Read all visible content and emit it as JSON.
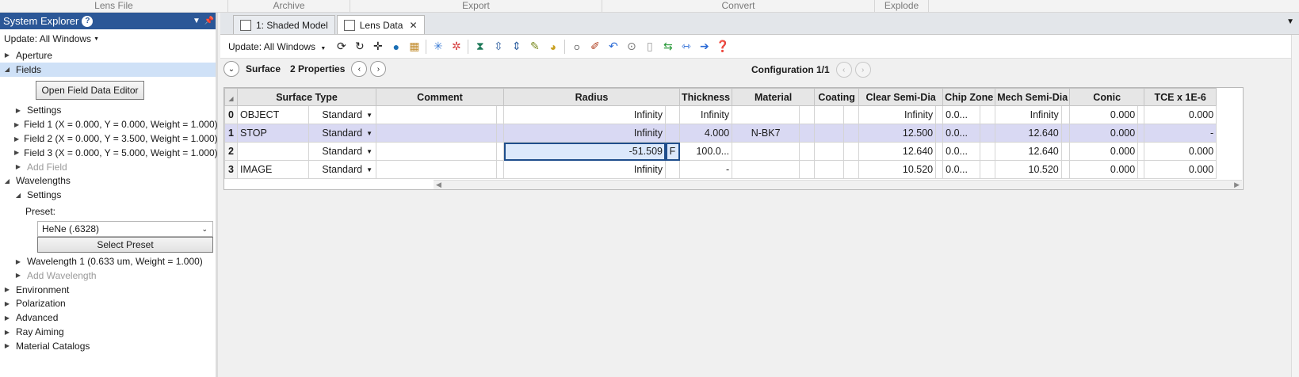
{
  "ribbon": {
    "groups": [
      "Lens File",
      "Archive",
      "Export",
      "Convert",
      "Explode"
    ]
  },
  "explorer": {
    "title": "System Explorer",
    "help": "?",
    "update_label": "Update: All Windows",
    "items": {
      "aperture": "Aperture",
      "fields": "Fields",
      "open_field_editor": "Open Field Data Editor",
      "field_settings": "Settings",
      "field1": "Field 1 (X = 0.000, Y = 0.000, Weight = 1.000)",
      "field2": "Field 2 (X = 0.000, Y = 3.500, Weight = 1.000)",
      "field3": "Field 3 (X = 0.000, Y = 5.000, Weight = 1.000)",
      "add_field": "Add Field",
      "wavelengths": "Wavelengths",
      "wl_settings": "Settings",
      "preset_label": "Preset:",
      "preset_value": "HeNe (.6328)",
      "select_preset": "Select Preset",
      "wavelength1": "Wavelength 1 (0.633 um, Weight = 1.000)",
      "add_wavelength": "Add Wavelength",
      "environment": "Environment",
      "polarization": "Polarization",
      "advanced": "Advanced",
      "ray_aiming": "Ray Aiming",
      "material_catalogs": "Material Catalogs"
    }
  },
  "tabs": [
    {
      "label": "1: Shaded Model"
    },
    {
      "label": "Lens Data"
    }
  ],
  "toolbar": {
    "update_label": "Update: All Windows"
  },
  "propbar": {
    "surface_label": "Surface",
    "properties_label": "2 Properties",
    "config_label": "Configuration 1/1"
  },
  "table": {
    "headers": [
      "Surface Type",
      "Comment",
      "Radius",
      "Thickness",
      "Material",
      "Coating",
      "Clear Semi-Dia",
      "Chip Zone",
      "Mech Semi-Dia",
      "Conic",
      "TCE x 1E-6"
    ],
    "rows": [
      {
        "num": "0",
        "name": "OBJECT",
        "type": "Standard",
        "comment": "",
        "radius": "Infinity",
        "radius_solve": "",
        "thickness": "Infinity",
        "material": "",
        "coating": "",
        "clear": "Infinity",
        "chip": "0.0...",
        "mech": "Infinity",
        "conic": "0.000",
        "tce": "0.000"
      },
      {
        "num": "1",
        "name": "STOP",
        "type": "Standard",
        "comment": "",
        "radius": "Infinity",
        "radius_solve": "",
        "thickness": "4.000",
        "material": "N-BK7",
        "coating": "",
        "clear": "12.500",
        "chip": "0.0...",
        "mech": "12.640",
        "conic": "0.000",
        "tce": "-"
      },
      {
        "num": "2",
        "name": "",
        "type": "Standard",
        "comment": "",
        "radius": "-51.509",
        "radius_solve": "F",
        "thickness": "100.0...",
        "material": "",
        "coating": "",
        "clear": "12.640",
        "chip": "0.0...",
        "mech": "12.640",
        "conic": "0.000",
        "tce": "0.000"
      },
      {
        "num": "3",
        "name": "IMAGE",
        "type": "Standard",
        "comment": "",
        "radius": "Infinity",
        "radius_solve": "",
        "thickness": "-",
        "material": "",
        "coating": "",
        "clear": "10.520",
        "chip": "0.0...",
        "mech": "10.520",
        "conic": "0.000",
        "tce": "0.000"
      }
    ]
  }
}
